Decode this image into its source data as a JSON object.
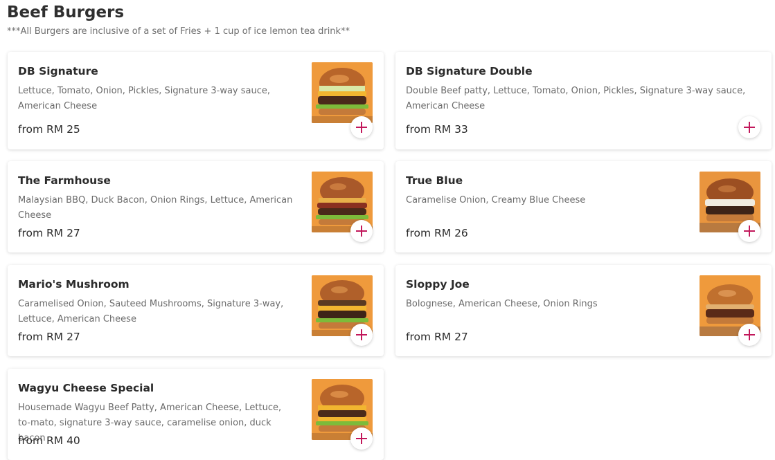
{
  "section": {
    "title": "Beef Burgers",
    "note": "***All Burgers are inclusive of a set of Fries + 1 cup of ice lemon tea drink**"
  },
  "colors": {
    "accent": "#c2185b",
    "image_bg": "#ef9a3c"
  },
  "items": [
    {
      "name": "DB Signature",
      "description": "Lettuce, Tomato, Onion, Pickles, Signature 3-way sauce, American Cheese",
      "price": "from RM 25",
      "image": "burger-photo"
    },
    {
      "name": "DB Signature Double",
      "description": "Double Beef patty, Lettuce, Tomato, Onion, Pickles, Signature 3-way sauce, American Cheese",
      "price": "from RM 33",
      "image": ""
    },
    {
      "name": "The Farmhouse",
      "description": "Malaysian BBQ, Duck Bacon, Onion Rings, Lettuce, American Cheese",
      "price": "from RM 27",
      "image": "burger-photo"
    },
    {
      "name": "True Blue",
      "description": "Caramelise Onion, Creamy Blue Cheese",
      "price": "from RM 26",
      "image": "burger-photo"
    },
    {
      "name": "Mario's Mushroom",
      "description": "Caramelised Onion, Sauteed Mushrooms, Signature 3-way, Lettuce, American Cheese",
      "price": "from RM 27",
      "image": "burger-photo"
    },
    {
      "name": "Sloppy Joe",
      "description": "Bolognese, American Cheese, Onion Rings",
      "price": "from RM 27",
      "image": "burger-photo"
    },
    {
      "name": "Wagyu Cheese Special",
      "description": "Housemade Wagyu Beef Patty, American Cheese, Lettuce, to-mato, signature 3-way sauce, caramelise onion, duck bacon",
      "price": "from RM 40",
      "image": "burger-photo"
    }
  ]
}
